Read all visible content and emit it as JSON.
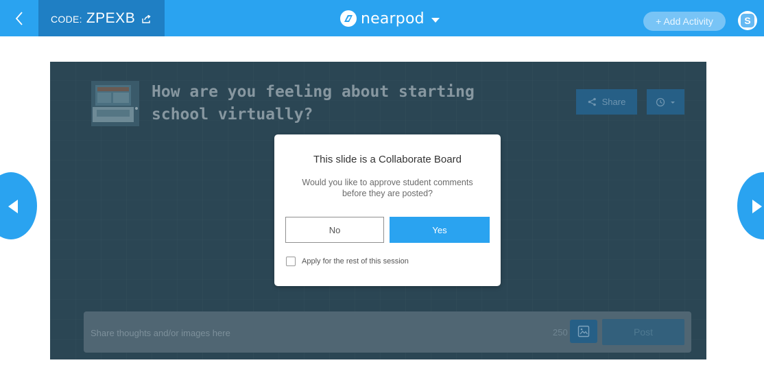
{
  "header": {
    "code_label": "CODE:",
    "code_value": "ZPEXB",
    "logo_text": "nearpod",
    "add_activity_label": "+ Add Activity",
    "avatar_letter": "S"
  },
  "board": {
    "question": "How are you feeling about starting school virtually?",
    "share_label": "Share",
    "composer_placeholder": "Share thoughts and/or images here",
    "char_count": "250",
    "post_label": "Post"
  },
  "modal": {
    "title": "This slide is a Collaborate Board",
    "message": "Would you like to approve student comments before they are posted?",
    "no_label": "No",
    "yes_label": "Yes",
    "apply_label": "Apply for the rest of this session",
    "apply_checked": false
  },
  "icons": {
    "back": "chevron-left-icon",
    "code_share": "external-share-icon",
    "logo": "nearpod-logo-icon",
    "logo_caret": "caret-down-icon",
    "share": "share-icon",
    "timer": "clock-icon",
    "image": "image-icon",
    "prev": "triangle-left-icon",
    "next": "triangle-right-icon"
  },
  "colors": {
    "brand": "#2aa3f0",
    "code_bg": "#1f7fc4",
    "board_bg": "#2b4654"
  }
}
